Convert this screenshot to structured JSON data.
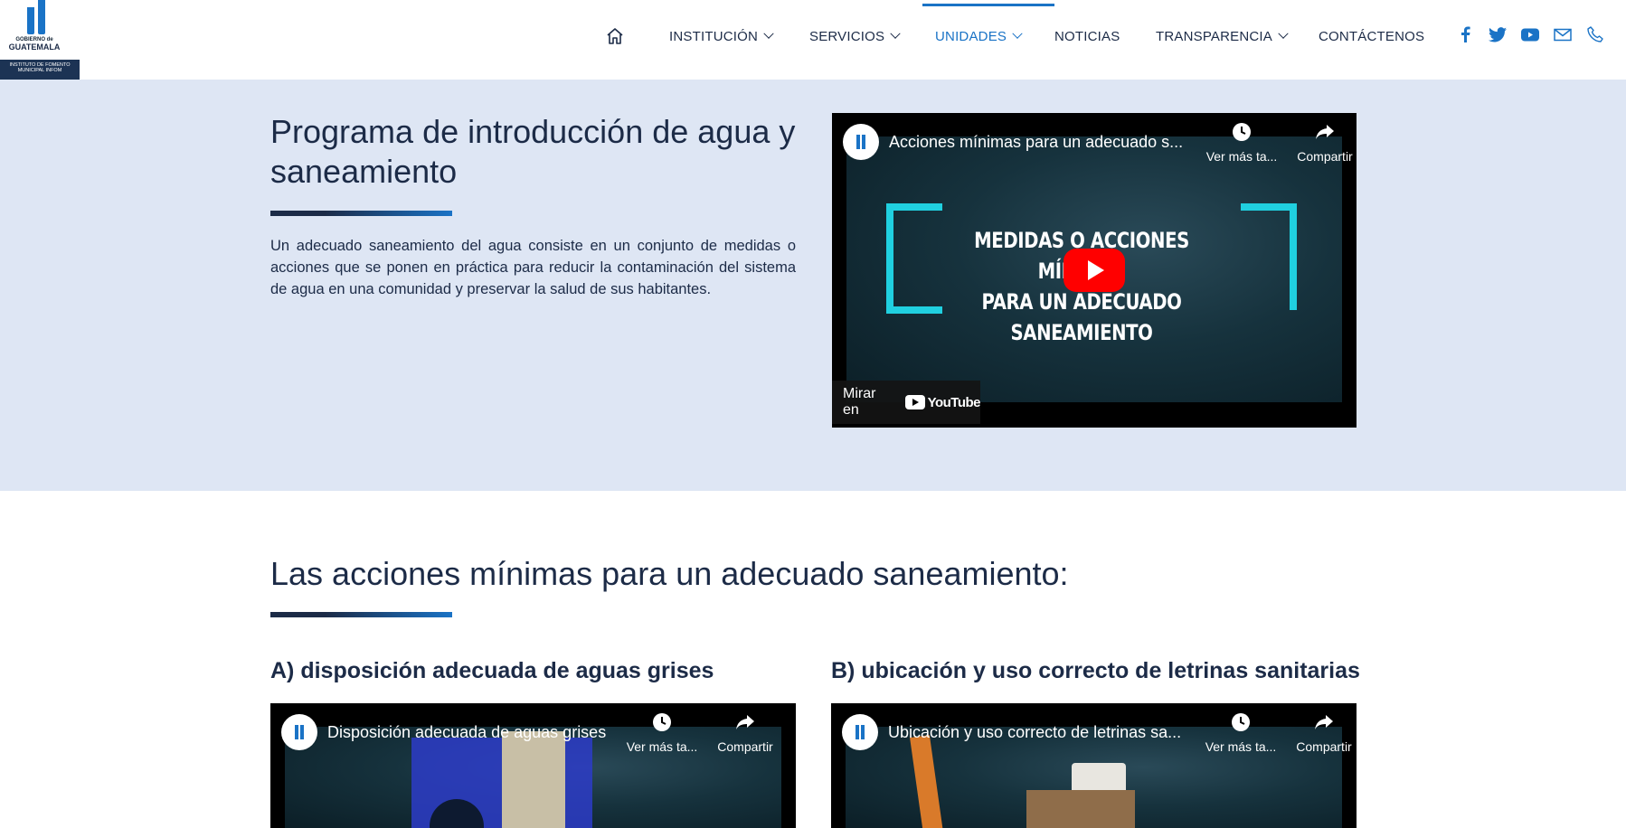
{
  "logo": {
    "line1": "GOBIERNO de",
    "line2": "GUATEMALA",
    "subtitle": "INSTITUTO DE FOMENTO MUNICIPAL INFOM"
  },
  "nav": {
    "items": [
      {
        "label": "INSTITUCIÓN",
        "dropdown": true
      },
      {
        "label": "SERVICIOS",
        "dropdown": true
      },
      {
        "label": "UNIDADES",
        "dropdown": true,
        "active": true
      },
      {
        "label": "NOTICIAS",
        "dropdown": false
      },
      {
        "label": "TRANSPARENCIA",
        "dropdown": true
      },
      {
        "label": "CONTÁCTENOS",
        "dropdown": false
      }
    ],
    "social_icons": [
      "facebook-icon",
      "twitter-icon",
      "youtube-icon",
      "mail-icon",
      "phone-icon"
    ]
  },
  "section1": {
    "title": "Programa de introducción de agua y saneamiento",
    "description": "Un adecuado saneamiento del agua consiste en un conjunto de medidas o acciones que se ponen en práctica para reducir la contaminación del sistema de agua en una comunidad y preservar la salud de sus habitantes.",
    "video": {
      "title": "Acciones mínimas para un adecuado s...",
      "watch_later": "Ver más ta...",
      "share": "Compartir",
      "watch_on": "Mirar en",
      "youtube": "YouTube",
      "frame_text_line1": "MEDIDAS O ACCIONES MÍNIMAS",
      "frame_text_line2": "PARA UN ADECUADO SANEAMIENTO"
    }
  },
  "section2": {
    "title": "Las acciones mínimas para un adecuado saneamiento:",
    "item_a": {
      "title": "A) disposición adecuada de aguas grises",
      "video_title": "Disposición adecuada de aguas grises",
      "watch_later": "Ver más ta...",
      "share": "Compartir"
    },
    "item_b": {
      "title": "B) ubicación y uso correcto de letrinas sanitarias",
      "video_title": "Ubicación y uso correcto de letrinas sa...",
      "watch_later": "Ver más ta...",
      "share": "Compartir"
    }
  },
  "colors": {
    "accent": "#1a73c6",
    "navy": "#1c2b47",
    "section_bg": "#dee6f4",
    "youtube_red": "#ff0000"
  }
}
